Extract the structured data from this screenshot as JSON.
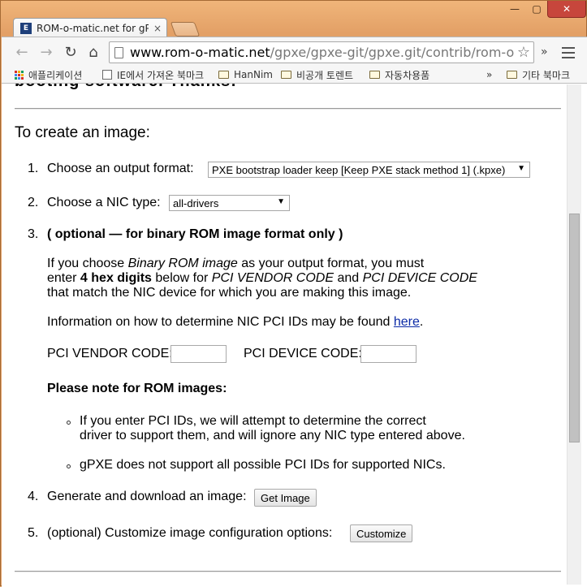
{
  "window": {
    "minimize": "—",
    "maximize": "▢",
    "close": "✕"
  },
  "tab": {
    "favicon_text": "E",
    "title": "ROM-o-matic.net for gPX",
    "close": "×"
  },
  "toolbar": {
    "back": "←",
    "forward": "→",
    "reload": "↻",
    "home": "⌂",
    "url_host": "www.rom-o-matic.net",
    "url_path": "/gpxe/gpxe-git/gpxe.git/contrib/rom-o-m",
    "star": "☆",
    "more": "»"
  },
  "bookmarks": {
    "apps_label": "애플리케이션",
    "items": [
      "IE에서 가져온 북마크",
      "HanNim",
      "비공개 토렌트",
      "자동차용품"
    ],
    "more": "»",
    "other": "기타 북마크"
  },
  "content": {
    "partial_heading": "booting software. Thanks!",
    "section_title": "To create an image:",
    "step1": {
      "num": "1.",
      "label": "Choose an output format:",
      "select_value": "PXE bootstrap loader keep [Keep PXE stack method 1] (.kpxe)"
    },
    "step2": {
      "num": "2.",
      "label": "Choose a NIC type:",
      "select_value": "all-drivers"
    },
    "step3": {
      "num": "3.",
      "heading": "( optional — for binary ROM image format only )",
      "p1_a": "If you choose ",
      "p1_b": "Binary ROM image",
      "p1_c": " as your output format, you must",
      "p2_a": "enter ",
      "p2_b": "4 hex digits",
      "p2_c": " below for ",
      "p2_d": "PCI VENDOR CODE",
      "p2_e": " and ",
      "p2_f": "PCI DEVICE CODE",
      "p3": "that match the NIC device for which you are making this image.",
      "info_a": "Information on how to determine NIC PCI IDs may be found ",
      "info_link": "here",
      "info_b": ".",
      "vendor_label": "PCI VENDOR CODE:",
      "device_label": "PCI DEVICE CODE:",
      "note_heading": "Please note for ROM images:",
      "bullet1_l1": "If you enter PCI IDs, we will attempt to determine the correct",
      "bullet1_l2": "driver to support them, and will ignore any NIC type entered above.",
      "bullet2": "gPXE does not support all possible PCI IDs for supported NICs."
    },
    "step4": {
      "num": "4.",
      "label": "Generate and download an image:",
      "button": "Get Image"
    },
    "step5": {
      "num": "5.",
      "label": "(optional) Customize image configuration options:",
      "button": "Customize"
    }
  }
}
